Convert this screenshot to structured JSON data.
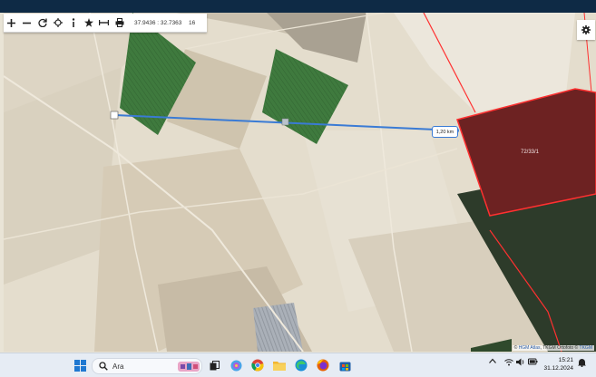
{
  "toolbar": {
    "coords": "37.9436 : 32.7363",
    "zoom": "16"
  },
  "map": {
    "measure_label": "1,20 km",
    "parcel_label": "72/33/1",
    "attribution_prefix": "©",
    "attribution_hgm": "HGM Atlas",
    "attribution_mid": ", TKGM Ortofoto ©",
    "attribution_tkgm": "TKGM"
  },
  "taskbar": {
    "search_placeholder": "Ara",
    "time": "15:21",
    "date": "31.12.2024"
  },
  "colors": {
    "title_bar": "#0e2a45",
    "measure_line": "#3a7bd5",
    "parcel_fill": "#6d2222",
    "parcel_border": "#ff3030"
  }
}
